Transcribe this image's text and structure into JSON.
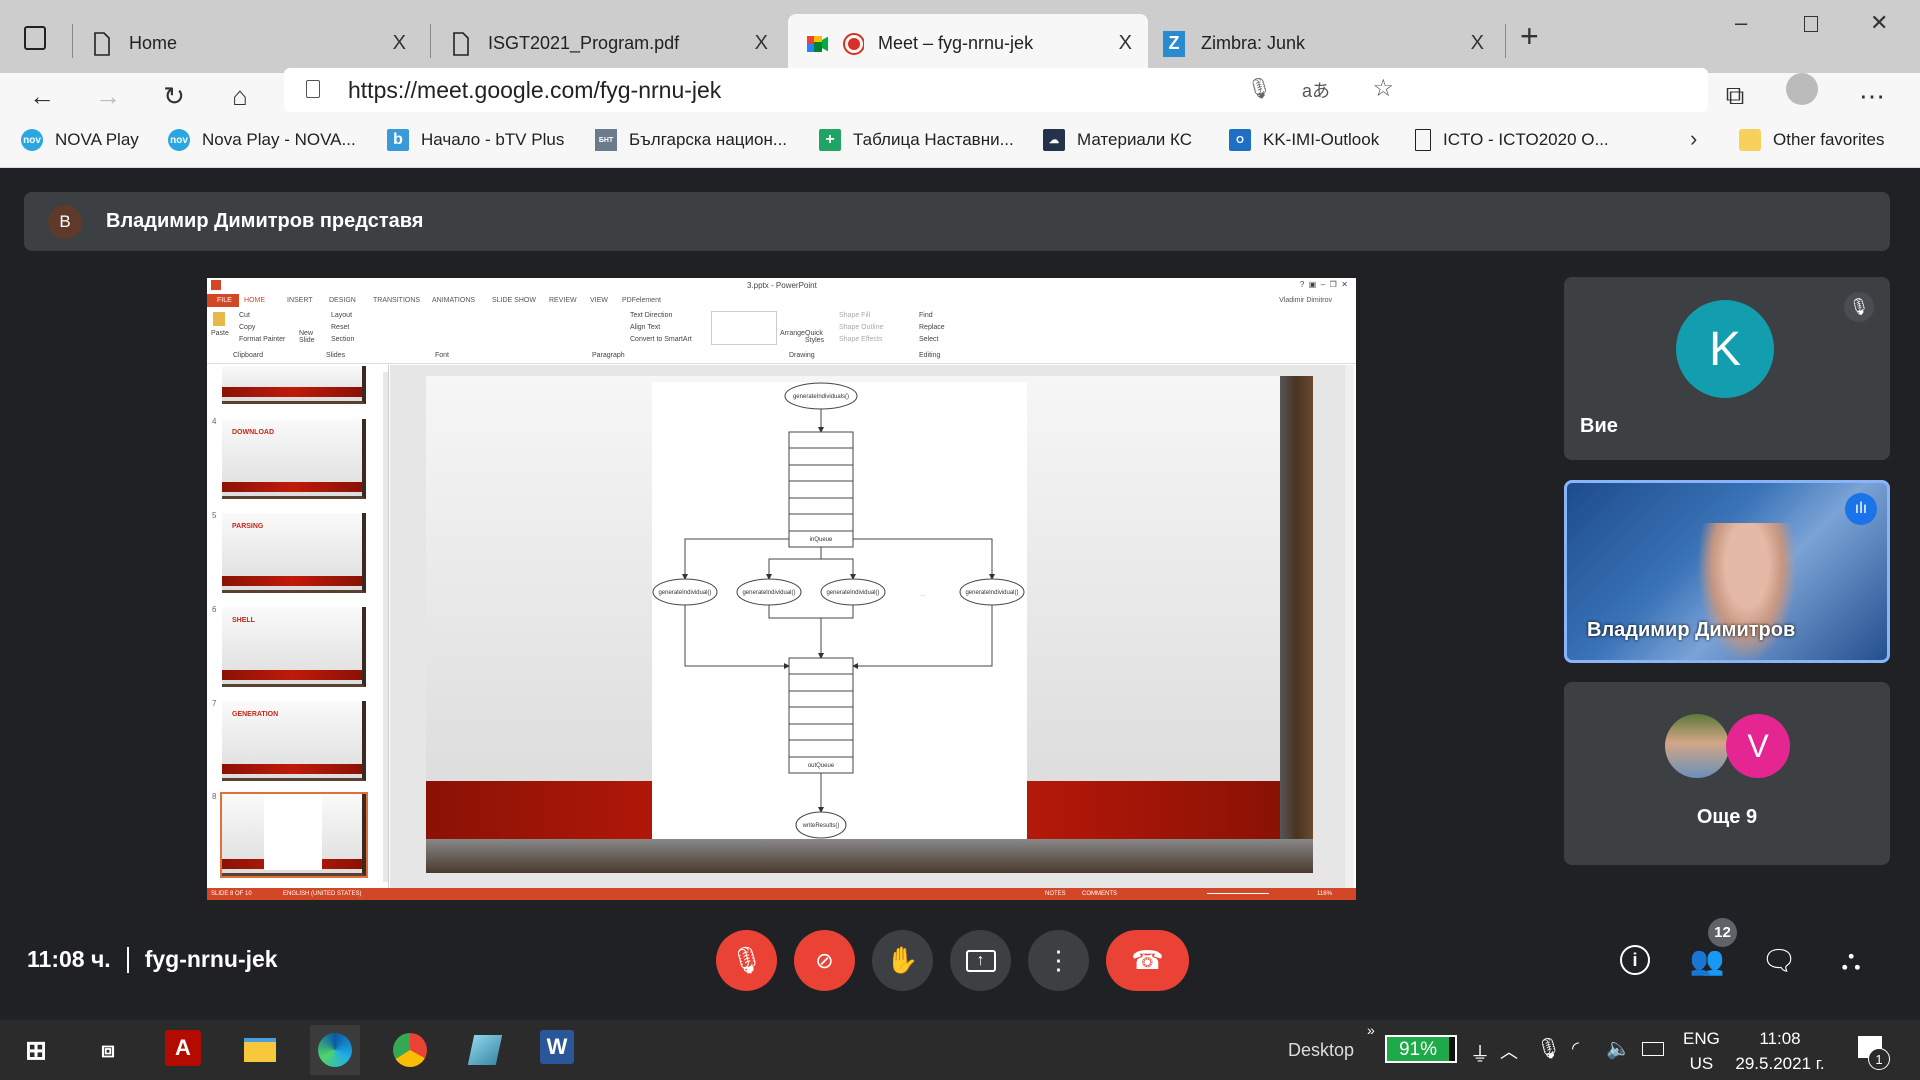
{
  "browser": {
    "tabs": [
      {
        "label": "Home",
        "icon": "page-icon"
      },
      {
        "label": "ISGT2021_Program.pdf",
        "icon": "page-icon"
      },
      {
        "label": "Meet – fyg-nrnu-jek",
        "icon": "meet-icon",
        "active": true
      },
      {
        "label": "Zimbra: Junk",
        "icon": "zimbra-icon"
      }
    ],
    "close_glyph": "X",
    "new_tab_glyph": "+",
    "url": "https://meet.google.com/fyg-nrnu-jek",
    "bookmarks": [
      {
        "label": "NOVA Play",
        "color": "#2aa6e0"
      },
      {
        "label": "Nova Play - NOVA...",
        "color": "#2aa6e0"
      },
      {
        "label": "Начало - bTV Plus",
        "color": "#3a9ad9"
      },
      {
        "label": "Българска национ...",
        "color": "#6b7b8c"
      },
      {
        "label": "Таблица Наставни...",
        "color": "#1fa463"
      },
      {
        "label": "Материали  КС",
        "color": "#23344a"
      },
      {
        "label": "KK-IMI-Outlook",
        "color": "#1f6fc5"
      },
      {
        "label": "ICTO - ICTO2020 O...",
        "color": "#ffffff"
      }
    ],
    "other_favorites": "Other favorites"
  },
  "meet": {
    "presenter_initial": "B",
    "presenter_banner": "Владимир Димитров представя",
    "time": "11:08 ч.",
    "meeting_code": "fyg-nrnu-jek",
    "participants_count": "12",
    "tiles": [
      {
        "initial": "K",
        "name": "Вие",
        "avatar_color": "#129eaf",
        "muted": true
      },
      {
        "name": "Владимир Димитров",
        "speaking": true
      },
      {
        "initial": "V",
        "name": "Още 9",
        "avatar_color": "#e52592"
      }
    ],
    "accent_red": "#ea4335",
    "active_border": "#8ab4f8"
  },
  "powerpoint": {
    "title": "3.pptx - PowerPoint",
    "user": "Vladimir Dimitrov",
    "ribbon_tabs": [
      "FILE",
      "HOME",
      "INSERT",
      "DESIGN",
      "TRANSITIONS",
      "ANIMATIONS",
      "SLIDE SHOW",
      "REVIEW",
      "VIEW",
      "PDFelement"
    ],
    "clipboard": {
      "paste": "Paste",
      "cut": "Cut",
      "copy": "Copy",
      "format_painter": "Format Painter",
      "group": "Clipboard"
    },
    "slides": {
      "new_slide": "New Slide",
      "layout": "Layout",
      "reset": "Reset",
      "section": "Section",
      "group": "Slides"
    },
    "font_group": "Font",
    "paragraph": {
      "text_direction": "Text Direction",
      "align_text": "Align Text",
      "convert": "Convert to SmartArt",
      "group": "Paragraph"
    },
    "drawing": {
      "arrange": "Arrange",
      "quick_styles": "Quick Styles",
      "shape_fill": "Shape Fill",
      "shape_outline": "Shape Outline",
      "shape_effects": "Shape Effects",
      "group": "Drawing"
    },
    "editing": {
      "find": "Find",
      "replace": "Replace",
      "select": "Select",
      "group": "Editing"
    },
    "thumbnails": [
      {
        "num": "4",
        "title": "DOWNLOAD"
      },
      {
        "num": "5",
        "title": "PARSING"
      },
      {
        "num": "6",
        "title": "SHELL"
      },
      {
        "num": "7",
        "title": "GENERATION"
      },
      {
        "num": "8",
        "title": ""
      }
    ],
    "status": {
      "slide": "SLIDE 8 OF 10",
      "language": "ENGLISH (UNITED STATES)",
      "notes": "NOTES",
      "comments": "COMMENTS",
      "zoom": "116%"
    },
    "zoom_level": 116,
    "diagram": {
      "top_node": "generateIndividuals()",
      "in_queue": "inQueue",
      "worker": "generateIndividual()",
      "ellipsis": "...",
      "out_queue": "outQueue",
      "bottom_node": "writeResults()"
    }
  },
  "taskbar": {
    "desktop": "Desktop",
    "battery": "91%",
    "battery_level": 91,
    "lang1": "ENG",
    "lang2": "US",
    "time": "11:08",
    "date": "29.5.2021 г.",
    "notifications": "1"
  }
}
